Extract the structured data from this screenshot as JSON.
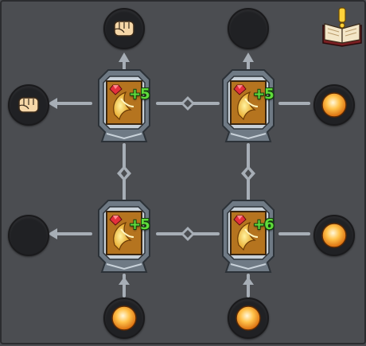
{
  "board": {
    "tiles": [
      {
        "id": "top-left",
        "bonus": "+5"
      },
      {
        "id": "top-right",
        "bonus": "+5"
      },
      {
        "id": "bottom-left",
        "bonus": "+5"
      },
      {
        "id": "bottom-right",
        "bonus": "+6"
      }
    ],
    "nodes": [
      {
        "id": "top-1",
        "content": "fist-icon"
      },
      {
        "id": "top-2",
        "content": "empty"
      },
      {
        "id": "left-1",
        "content": "fist-icon"
      },
      {
        "id": "left-2",
        "content": "empty"
      },
      {
        "id": "right-1",
        "content": "orb-icon"
      },
      {
        "id": "right-2",
        "content": "orb-icon"
      },
      {
        "id": "bottom-1",
        "content": "orb-icon"
      },
      {
        "id": "bottom-2",
        "content": "orb-icon"
      }
    ]
  },
  "colors": {
    "background": "#4b4d51",
    "connector": "#a7aeb6",
    "frame": "#8f99a3",
    "tile_fill": "#b5741f",
    "bonus_text": "#5fdc3c",
    "orb": "#f6a123"
  },
  "icons": {
    "corner": "lore-book-alert-icon",
    "tile_art": "golden-claw-icon",
    "tile_gem": "red-gem-icon"
  }
}
